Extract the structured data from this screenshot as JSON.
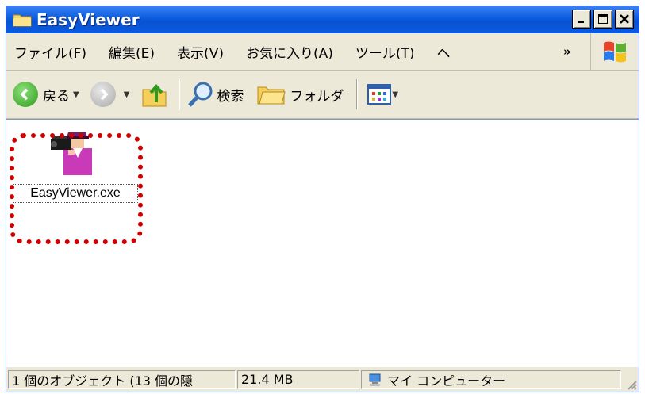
{
  "window": {
    "title": "EasyViewer"
  },
  "menu": {
    "items": [
      "ファイル(F)",
      "編集(E)",
      "表示(V)",
      "お気に入り(A)",
      "ツール(T)",
      "ヘ"
    ],
    "overflow": "»"
  },
  "toolbar": {
    "back_label": "戻る",
    "search_label": "検索",
    "folders_label": "フォルダ"
  },
  "files": [
    {
      "name": "EasyViewer.exe",
      "icon": "camera-operator-icon",
      "selected_highlight": true
    }
  ],
  "status": {
    "objects": "1 個のオブジェクト (13 個の隠",
    "size": "21.4 MB",
    "location": "マイ コンピューター"
  },
  "colors": {
    "titlebar": "#0a5ce0",
    "highlight": "#d10000"
  }
}
